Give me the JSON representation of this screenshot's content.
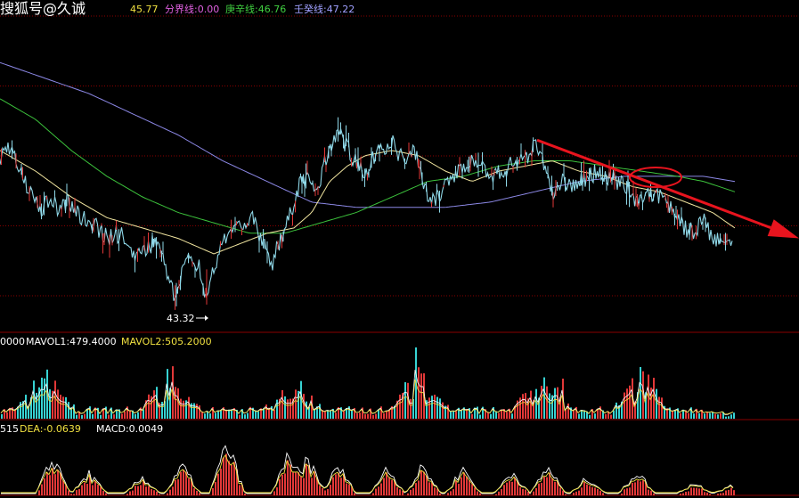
{
  "watermark": "搜狐号@久诚",
  "header": {
    "line1_value": "45.77",
    "line2_label": "分界线:0.00",
    "line3_label": "庚辛线:46.76",
    "line4_label": "壬癸线:47.22"
  },
  "price_panel": {
    "low_label": "43.32",
    "gridline_count": 5
  },
  "volume_panel": {
    "label_prefix": "0000",
    "mavol1": "MAVOL1:479.4000",
    "mavol2": "MAVOL2:505.2000"
  },
  "macd_panel": {
    "label_prefix": "515",
    "dea": "DEA:-0.0639",
    "macd": "MACD:0.0049"
  },
  "colors": {
    "background": "#000000",
    "grid": "#8a0000",
    "price": "#8fd8e8",
    "ma_yellow": "#f2e6a0",
    "ma_green": "#3cc23c",
    "ma_purple": "#8c88e6",
    "trend_arrow": "#e8141e",
    "vol_up": "#e23838",
    "vol_down": "#37d3d3",
    "macd_bar": "#e23838",
    "label_white": "#ffffff",
    "label_yellow": "#f0e040",
    "label_magenta": "#e060e0",
    "label_green": "#40d040",
    "label_purple": "#a0a0ff"
  },
  "chart_data": {
    "type": "line",
    "title": "",
    "series": [
      {
        "values_key": "price_anchor",
        "kind": "price"
      },
      {
        "kind": "ma_short"
      },
      {
        "kind": "ma_medium"
      },
      {
        "kind": "ma_long"
      }
    ],
    "price_anchor": [
      [
        0,
        46.2
      ],
      [
        10,
        46.4
      ],
      [
        20,
        46.0
      ],
      [
        30,
        45.6
      ],
      [
        45,
        45.1
      ],
      [
        55,
        45.4
      ],
      [
        65,
        45.2
      ],
      [
        75,
        45.3
      ],
      [
        90,
        45.0
      ],
      [
        105,
        44.9
      ],
      [
        120,
        44.6
      ],
      [
        135,
        44.7
      ],
      [
        150,
        44.2
      ],
      [
        160,
        44.3
      ],
      [
        175,
        44.6
      ],
      [
        185,
        44.1
      ],
      [
        195,
        43.5
      ],
      [
        205,
        44.0
      ],
      [
        215,
        44.3
      ],
      [
        225,
        44.0
      ],
      [
        232,
        43.32
      ],
      [
        240,
        44.0
      ],
      [
        250,
        44.5
      ],
      [
        260,
        44.8
      ],
      [
        270,
        44.9
      ],
      [
        285,
        45.0
      ],
      [
        295,
        44.5
      ],
      [
        305,
        44.1
      ],
      [
        315,
        44.6
      ],
      [
        325,
        45.0
      ],
      [
        335,
        45.6
      ],
      [
        345,
        45.8
      ],
      [
        355,
        45.5
      ],
      [
        365,
        46.1
      ],
      [
        372,
        46.4
      ],
      [
        382,
        46.6
      ],
      [
        395,
        46.2
      ],
      [
        410,
        45.9
      ],
      [
        425,
        46.3
      ],
      [
        440,
        46.5
      ],
      [
        455,
        46.0
      ],
      [
        465,
        46.4
      ],
      [
        475,
        45.6
      ],
      [
        485,
        45.3
      ],
      [
        495,
        45.5
      ],
      [
        505,
        45.7
      ],
      [
        515,
        45.9
      ],
      [
        525,
        46.1
      ],
      [
        540,
        46.0
      ],
      [
        555,
        45.8
      ],
      [
        565,
        45.9
      ],
      [
        580,
        46.1
      ],
      [
        592,
        46.2
      ],
      [
        603,
        46.4
      ],
      [
        612,
        45.9
      ],
      [
        620,
        45.5
      ],
      [
        632,
        45.7
      ],
      [
        645,
        45.6
      ],
      [
        660,
        45.8
      ],
      [
        675,
        45.9
      ],
      [
        690,
        45.7
      ],
      [
        705,
        45.6
      ],
      [
        715,
        45.3
      ],
      [
        725,
        45.5
      ],
      [
        740,
        45.4
      ],
      [
        752,
        45.2
      ],
      [
        762,
        45.0
      ],
      [
        772,
        44.7
      ],
      [
        782,
        44.8
      ],
      [
        790,
        45.0
      ],
      [
        798,
        44.6
      ],
      [
        810,
        44.5
      ],
      [
        822,
        44.4
      ]
    ],
    "ma_short_anchor": [
      [
        0,
        46.3
      ],
      [
        40,
        45.9
      ],
      [
        80,
        45.4
      ],
      [
        120,
        45.0
      ],
      [
        160,
        44.8
      ],
      [
        200,
        44.6
      ],
      [
        240,
        44.3
      ],
      [
        270,
        44.5
      ],
      [
        300,
        44.7
      ],
      [
        330,
        44.8
      ],
      [
        350,
        45.1
      ],
      [
        370,
        45.7
      ],
      [
        390,
        46.0
      ],
      [
        410,
        46.2
      ],
      [
        440,
        46.3
      ],
      [
        470,
        46.2
      ],
      [
        500,
        45.9
      ],
      [
        530,
        45.7
      ],
      [
        560,
        45.9
      ],
      [
        590,
        46.0
      ],
      [
        620,
        46.1
      ],
      [
        650,
        45.9
      ],
      [
        680,
        45.8
      ],
      [
        710,
        45.6
      ],
      [
        740,
        45.5
      ],
      [
        770,
        45.3
      ],
      [
        800,
        45.1
      ],
      [
        825,
        44.8
      ]
    ],
    "ma_medium_anchor": [
      [
        0,
        47.3
      ],
      [
        40,
        46.9
      ],
      [
        80,
        46.3
      ],
      [
        120,
        45.8
      ],
      [
        160,
        45.4
      ],
      [
        200,
        45.1
      ],
      [
        240,
        44.9
      ],
      [
        280,
        44.7
      ],
      [
        320,
        44.7
      ],
      [
        360,
        44.9
      ],
      [
        400,
        45.1
      ],
      [
        440,
        45.4
      ],
      [
        480,
        45.7
      ],
      [
        520,
        45.8
      ],
      [
        560,
        46.0
      ],
      [
        600,
        46.1
      ],
      [
        640,
        46.1
      ],
      [
        680,
        46.0
      ],
      [
        720,
        45.9
      ],
      [
        760,
        45.8
      ],
      [
        790,
        45.7
      ],
      [
        825,
        45.5
      ]
    ],
    "ma_long_anchor": [
      [
        0,
        48.0
      ],
      [
        50,
        47.7
      ],
      [
        100,
        47.4
      ],
      [
        150,
        47.0
      ],
      [
        200,
        46.6
      ],
      [
        250,
        46.1
      ],
      [
        300,
        45.7
      ],
      [
        350,
        45.3
      ],
      [
        400,
        45.2
      ],
      [
        450,
        45.2
      ],
      [
        500,
        45.2
      ],
      [
        550,
        45.3
      ],
      [
        600,
        45.5
      ],
      [
        650,
        45.7
      ],
      [
        700,
        45.8
      ],
      [
        750,
        45.8
      ],
      [
        790,
        45.8
      ],
      [
        825,
        45.7
      ]
    ],
    "trend_arrow": {
      "from": [
        603,
        46.5
      ],
      "to": [
        897,
        44.6
      ]
    },
    "highlight_ellipse": {
      "center": [
        736,
        45.78
      ]
    },
    "y_range": [
      42.8,
      48.9
    ]
  }
}
